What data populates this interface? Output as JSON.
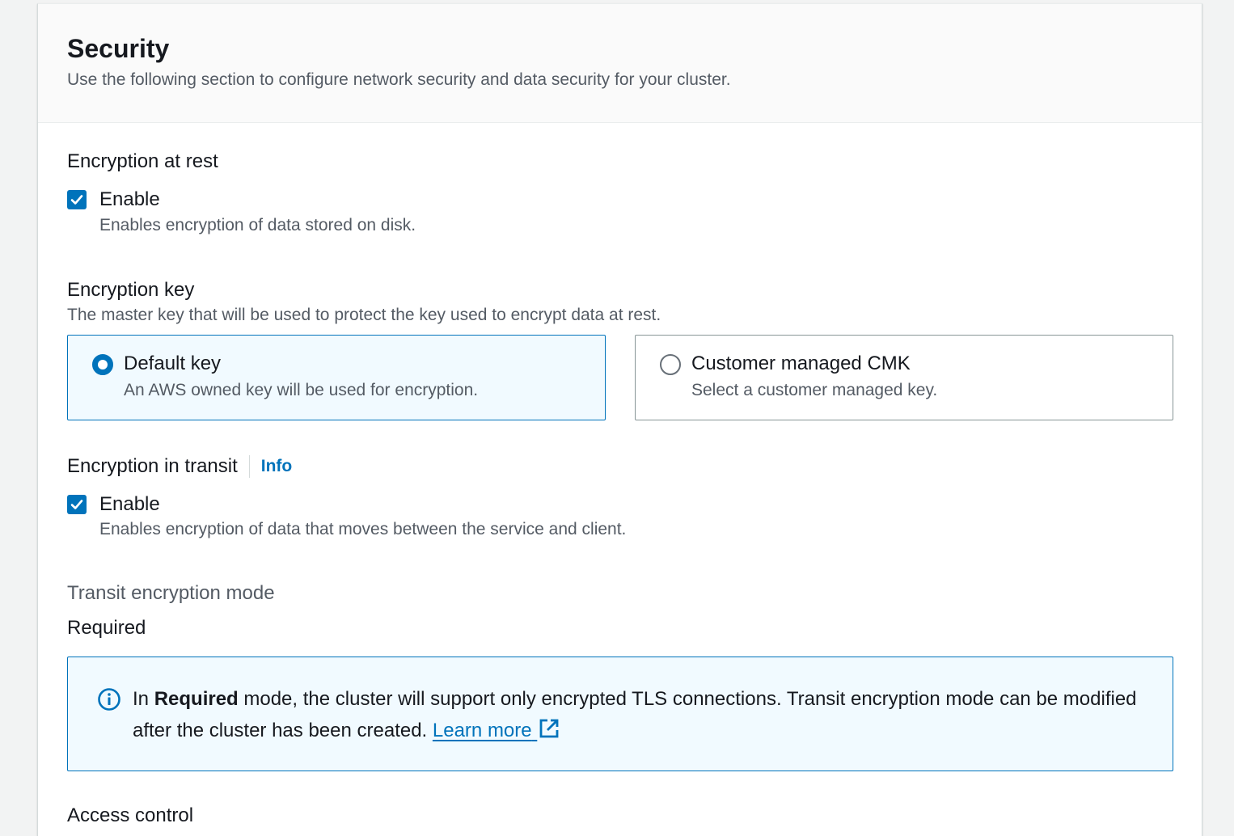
{
  "header": {
    "title": "Security",
    "description": "Use the following section to configure network security and data security for your cluster."
  },
  "encryption_at_rest": {
    "label": "Encryption at rest",
    "checkbox_label": "Enable",
    "checkbox_checked": true,
    "checkbox_description": "Enables encryption of data stored on disk."
  },
  "encryption_key": {
    "label": "Encryption key",
    "description": "The master key that will be used to protect the key used to encrypt data at rest.",
    "options": [
      {
        "label": "Default key",
        "description": "An AWS owned key will be used for encryption.",
        "selected": true
      },
      {
        "label": "Customer managed CMK",
        "description": "Select a customer managed key.",
        "selected": false
      }
    ]
  },
  "encryption_in_transit": {
    "label": "Encryption in transit",
    "info_link": "Info",
    "checkbox_label": "Enable",
    "checkbox_checked": true,
    "checkbox_description": "Enables encryption of data that moves between the service and client."
  },
  "transit_mode": {
    "label": "Transit encryption mode",
    "value": "Required"
  },
  "alert": {
    "prefix": "In ",
    "bold": "Required",
    "text": " mode, the cluster will support only encrypted TLS connections. Transit encryption mode can be modified after the cluster has been created. ",
    "link": "Learn more",
    "icon": "info-icon",
    "link_icon": "external-link-icon"
  },
  "access_control": {
    "label": "Access control"
  },
  "colors": {
    "accent": "#0073bb",
    "selected_bg": "#f1faff",
    "secondary_text": "#545b64"
  }
}
